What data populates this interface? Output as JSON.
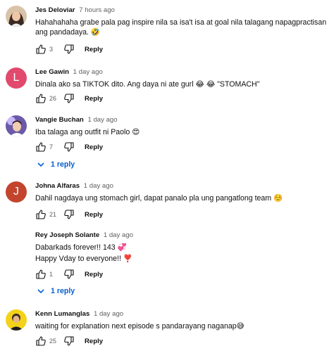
{
  "colors": {
    "accent": "#065fd4",
    "avatar_l": "#e14a6d",
    "avatar_j": "#c3452d"
  },
  "comments": [
    {
      "author": "Jes Deloviar",
      "time": "7 hours ago",
      "text": "Hahahahaha grabe pala pag inspire nila sa isa't isa at goal nila talagang napagpractisan ang pandadaya. 🤣",
      "likes": "3",
      "reply_label": "Reply",
      "avatar": "photo-avatar"
    },
    {
      "author": "Lee Gawin",
      "time": "1 day ago",
      "text": "Dinala ako sa TIKTOK dito. Ang daya ni ate gurl 😂 😂 \"STOMACH\"",
      "likes": "26",
      "reply_label": "Reply",
      "avatar_letter": "L"
    },
    {
      "author": "Vangie Buchan",
      "time": "1 day ago",
      "text": "Iba talaga ang outfit ni Paolo 😍",
      "likes": "7",
      "reply_label": "Reply",
      "replies_label": "1 reply",
      "avatar": "photo-avatar"
    },
    {
      "author": "Johna Alfaras",
      "time": "1 day ago",
      "text": "Dahil nagdaya ung stomach girl, dapat panalo pla ung pangatlong team ☺️",
      "likes": "21",
      "reply_label": "Reply",
      "avatar_letter": "J"
    },
    {
      "author": "Rey Joseph Solante",
      "time": "1 day ago",
      "text": "Dabarkads forever!! 143 💞",
      "text2": "Happy Vday to everyone!! ❣️",
      "likes": "1",
      "reply_label": "Reply",
      "replies_label": "1 reply"
    },
    {
      "author": "Kenn Lumanglas",
      "time": "1 day ago",
      "text": "waiting for explanation next episode s pandarayang naganap😅",
      "likes": "25",
      "reply_label": "Reply",
      "avatar": "photo-avatar"
    }
  ]
}
